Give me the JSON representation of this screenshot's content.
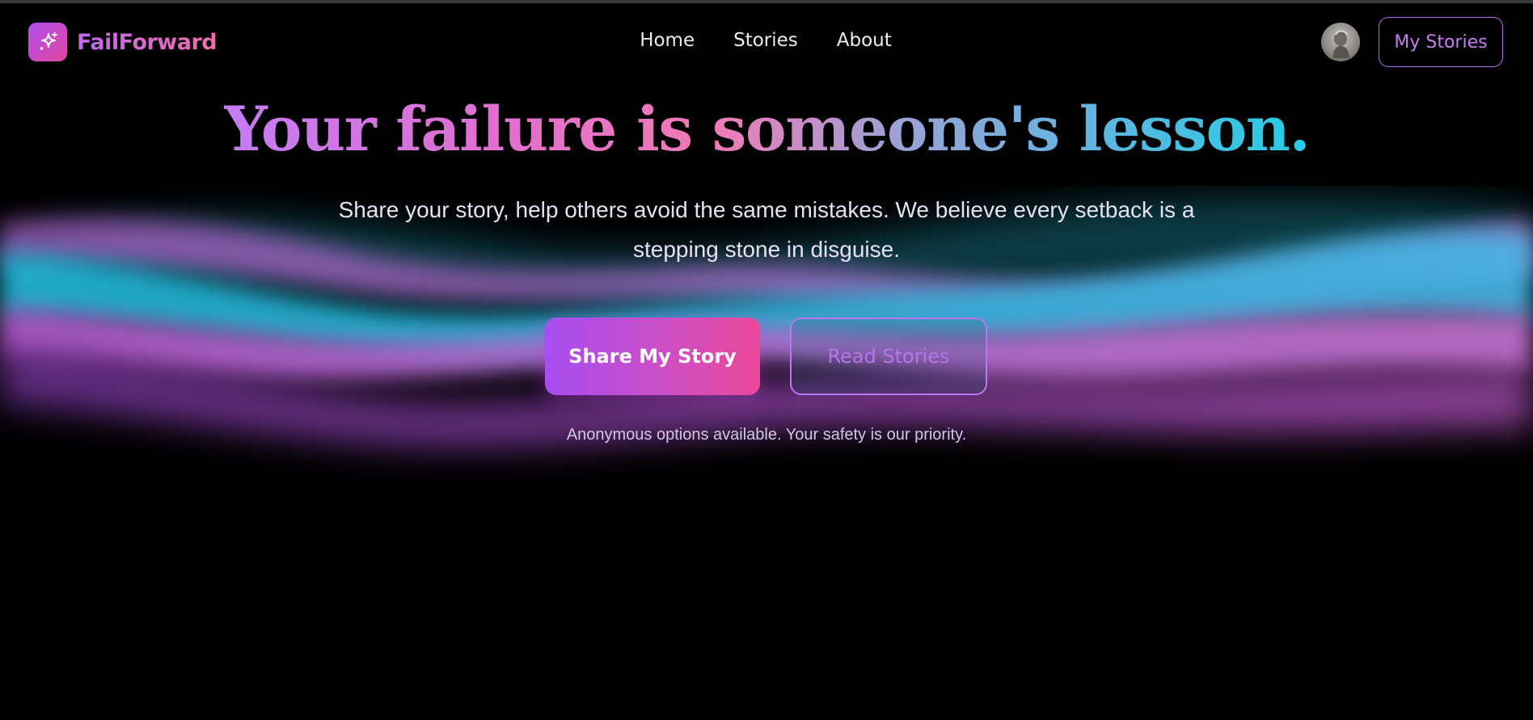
{
  "brand": {
    "name": "FailForward",
    "logo_icon": "sparkles-icon",
    "accent_from": "#a855f7",
    "accent_to": "#ec4899"
  },
  "nav": {
    "links": [
      {
        "label": "Home"
      },
      {
        "label": "Stories"
      },
      {
        "label": "About"
      }
    ],
    "avatar_icon": "user-avatar",
    "my_stories_label": "My Stories"
  },
  "hero": {
    "headline": "Your failure is someone's lesson.",
    "subtitle": "Share your story, help others avoid the same mistakes. We believe every setback is a stepping stone in disguise.",
    "primary_cta": "Share My Story",
    "secondary_cta": "Read Stories",
    "note": "Anonymous options available. Your safety is our priority."
  },
  "colors": {
    "background": "#000000",
    "aurora_pink": "#e879f9",
    "aurora_cyan": "#22d3ee",
    "aurora_purple": "#a855f7"
  }
}
